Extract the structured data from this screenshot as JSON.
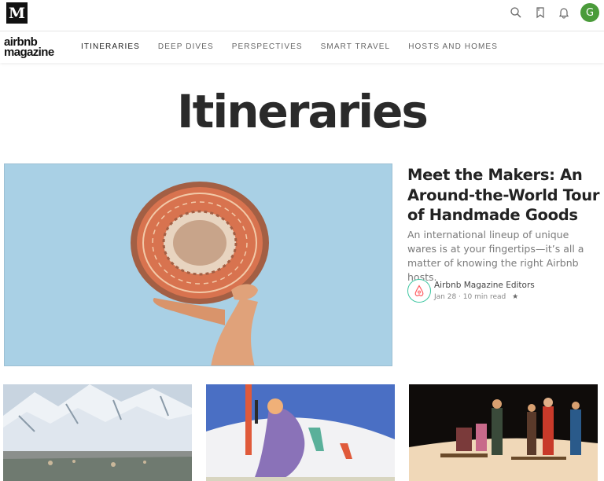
{
  "topbar": {
    "logo_letter": "M",
    "icons": [
      "search-icon",
      "bookmark-icon",
      "bell-icon"
    ],
    "avatar_letter": "G",
    "avatar_color": "#4a9b3a"
  },
  "publication": {
    "logo_line1": "airbnb",
    "logo_line2": "magazine",
    "nav": [
      {
        "label": "ITINERARIES",
        "active": true
      },
      {
        "label": "DEEP DIVES",
        "active": false
      },
      {
        "label": "PERSPECTIVES",
        "active": false
      },
      {
        "label": "SMART TRAVEL",
        "active": false
      },
      {
        "label": "HOSTS AND HOMES",
        "active": false
      }
    ]
  },
  "page": {
    "title": "Itineraries"
  },
  "hero": {
    "headline": "Meet the Makers: An Around-the-World Tour of Handmade Goods",
    "subtitle": "An international lineup of unique wares is at your fingertips—it’s all a matter of knowing the right Airbnb hosts.",
    "author": "Airbnb Magazine Editors",
    "date": "Jan 28",
    "read_time": "10 min read",
    "star": "★",
    "brand_color": "#ff5a5f"
  },
  "cards": [
    {
      "image": "snowy-mountain-town"
    },
    {
      "image": "skier-illustration"
    },
    {
      "image": "night-sledding-group"
    }
  ]
}
